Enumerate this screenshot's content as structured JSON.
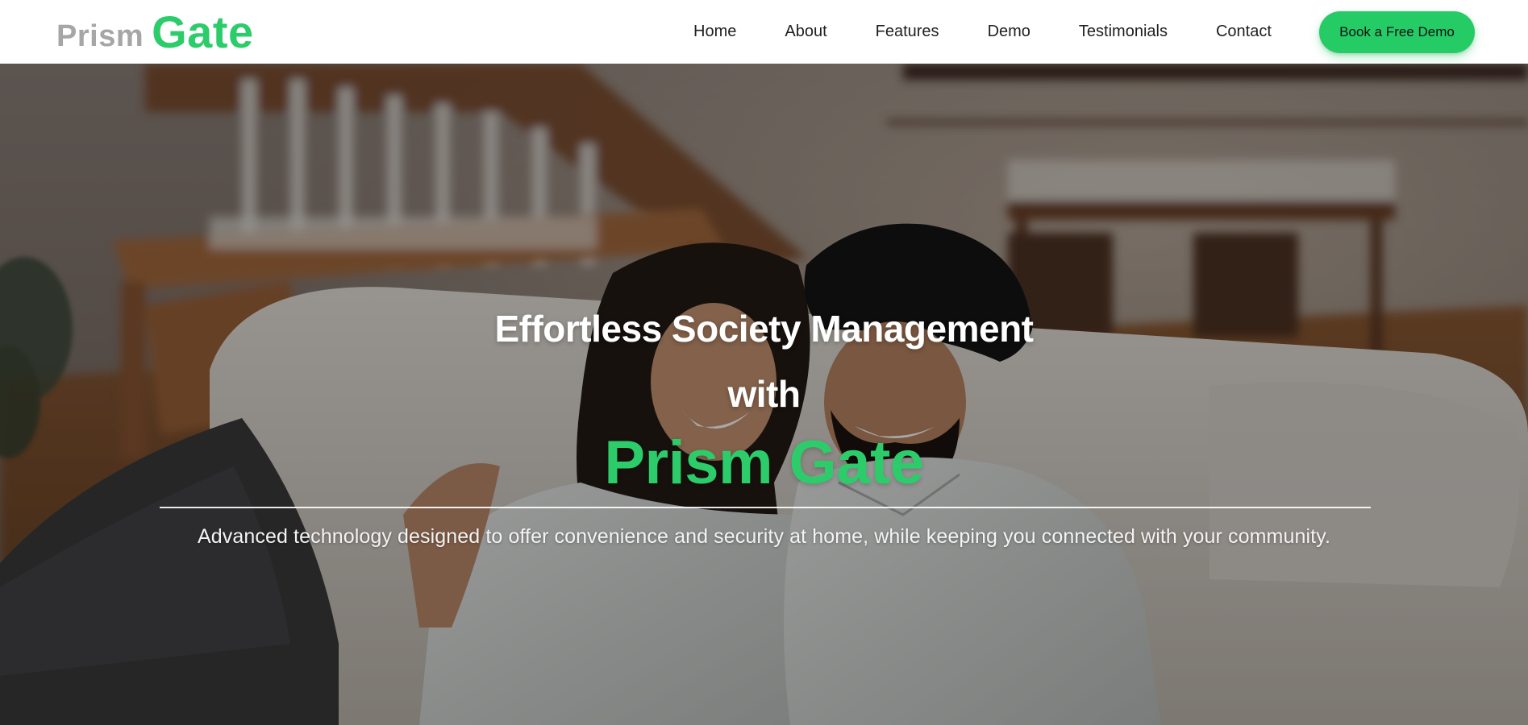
{
  "brand": {
    "word1": "Prism",
    "word2": "Gate",
    "accent_color": "#2dcc6a",
    "muted_color": "#a6a6a6"
  },
  "nav": {
    "items": [
      {
        "label": "Home"
      },
      {
        "label": "About"
      },
      {
        "label": "Features"
      },
      {
        "label": "Demo"
      },
      {
        "label": "Testimonials"
      },
      {
        "label": "Contact"
      }
    ],
    "cta_label": "Book a Free Demo",
    "cta_color": "#25cc66"
  },
  "hero": {
    "line1": "Effortless Society Management",
    "line2": "with",
    "brand": "Prism Gate",
    "subtitle": "Advanced technology designed to offer convenience and security at home, while keeping you connected with your community.",
    "background_image": "couple-smiling-on-sofa-photo"
  }
}
